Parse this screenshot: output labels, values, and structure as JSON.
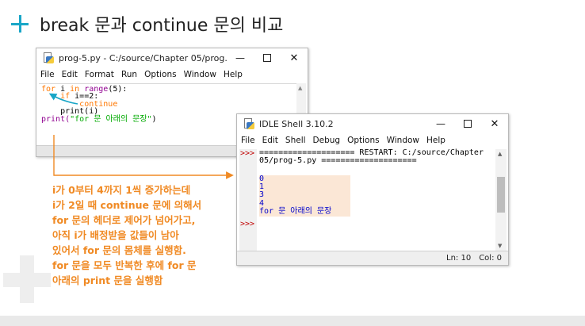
{
  "heading": {
    "text": "break 문과 continue 문의 비교"
  },
  "editor": {
    "title": "prog-5.py - C:/source/Chapter 05/prog...",
    "menu": [
      "File",
      "Edit",
      "Format",
      "Run",
      "Options",
      "Window",
      "Help"
    ],
    "code": {
      "line1_kw": "for",
      "line1_a": " i ",
      "line1_kw2": "in",
      "line1_sp": " ",
      "line1_bi": "range",
      "line1_b": "(5):",
      "line2_indent": "    ",
      "line2_kw": "if",
      "line2_b": " i==2:",
      "line3_indent": "        ",
      "line3_kw": "continue",
      "line4": "    print(i)",
      "line5_a": "print(",
      "line5_str": "\"for 문 아래의 문장\"",
      "line5_b": ")"
    }
  },
  "shell": {
    "title": "IDLE Shell 3.10.2",
    "menu": [
      "File",
      "Edit",
      "Shell",
      "Debug",
      "Options",
      "Window",
      "Help"
    ],
    "prompt": ">>>",
    "restart_line1": "==================== RESTART: C:/source/Chapter",
    "restart_line2": "05/prog-5.py ====================",
    "output": [
      "0",
      "1",
      "3",
      "4",
      "for 문 아래의 문장"
    ],
    "status_ln": "Ln: 10",
    "status_col": "Col: 0"
  },
  "explanation": [
    "i가 0부터 4까지 1씩 증가하는데",
    "i가 2일 때 continue 문에 의해서",
    "for 문의 헤더로 제어가 넘어가고,",
    "아직 i가 배정받을 값들이 남아",
    "있어서 for 문의 몸체를 실행함.",
    "for 문을 모두 반복한 후에 for 문",
    "아래의 print 문을 실행함"
  ],
  "colors": {
    "accent_teal": "#19a6c7",
    "annotation_orange": "#f08a24",
    "output_highlight": "#fbe7d6"
  }
}
